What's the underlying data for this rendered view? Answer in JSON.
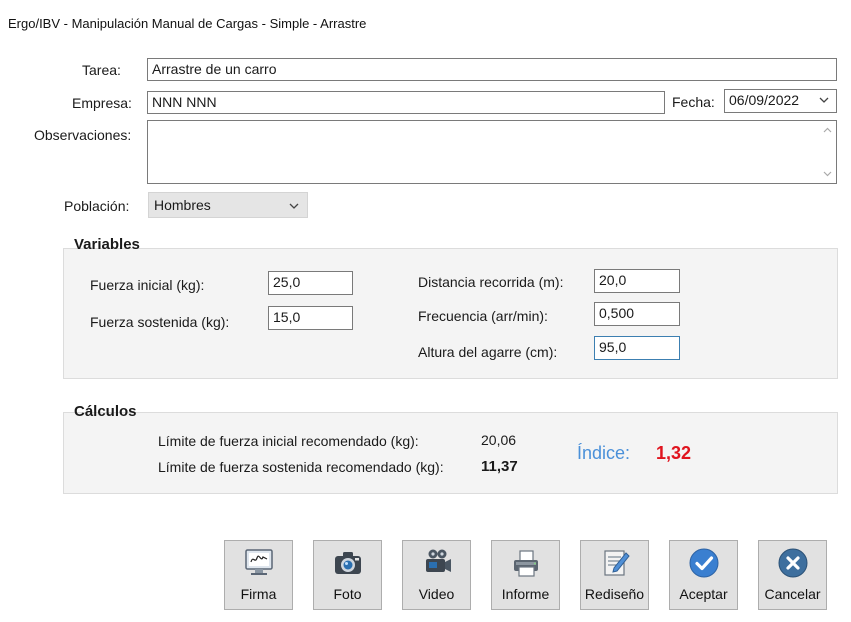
{
  "window": {
    "title": "Ergo/IBV - Manipulación Manual de Cargas - Simple - Arrastre"
  },
  "form": {
    "tarea_label": "Tarea:",
    "tarea_value": "Arrastre de un carro",
    "empresa_label": "Empresa:",
    "empresa_value": "NNN NNN",
    "fecha_label": "Fecha:",
    "fecha_value": "06/09/2022",
    "observaciones_label": "Observaciones:",
    "observaciones_value": "",
    "poblacion_label": "Población:",
    "poblacion_value": "Hombres"
  },
  "variables": {
    "title": "Variables",
    "fuerza_inicial_label": "Fuerza inicial (kg):",
    "fuerza_inicial_value": "25,0",
    "fuerza_sostenida_label": "Fuerza sostenida (kg):",
    "fuerza_sostenida_value": "15,0",
    "distancia_label": "Distancia recorrida (m):",
    "distancia_value": "20,0",
    "frecuencia_label": "Frecuencia (arr/min):",
    "frecuencia_value": "0,500",
    "altura_label": "Altura del agarre (cm):",
    "altura_value": "95,0"
  },
  "calculos": {
    "title": "Cálculos",
    "limite_inicial_label": "Límite de fuerza inicial recomendado (kg):",
    "limite_inicial_value": "20,06",
    "limite_sostenida_label": "Límite de fuerza sostenida recomendado (kg):",
    "limite_sostenida_value": "11,37",
    "indice_label": "Índice:",
    "indice_value": "1,32",
    "indice_label_color": "#4a90d9",
    "indice_value_color": "#e0141e"
  },
  "buttons": {
    "firma": "Firma",
    "foto": "Foto",
    "video": "Video",
    "informe": "Informe",
    "rediseno": "Rediseño",
    "aceptar": "Aceptar",
    "cancelar": "Cancelar"
  },
  "icons": {
    "firma": "signature-monitor-icon",
    "foto": "camera-icon",
    "video": "video-camera-icon",
    "informe": "printer-icon",
    "rediseno": "notepad-pencil-icon",
    "aceptar": "checkmark-circle-icon",
    "cancelar": "close-circle-icon",
    "accent_blue": "#3a7fd0",
    "cancel_blue": "#3e6f9e"
  }
}
